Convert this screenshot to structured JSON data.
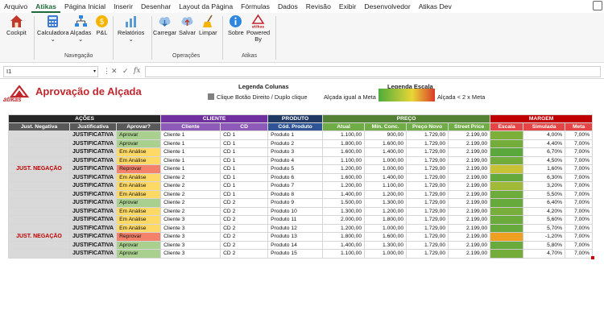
{
  "menu": [
    "Arquivo",
    "Atikas",
    "Página Inicial",
    "Inserir",
    "Desenhar",
    "Layout da Página",
    "Fórmulas",
    "Dados",
    "Revisão",
    "Exibir",
    "Desenvolvedor",
    "Atikas Dev"
  ],
  "menu_active_index": 1,
  "ribbon": {
    "cockpit": "Cockpit",
    "calculadora": "Calculadora",
    "alcadas": "Alçadas",
    "pl": "P&L",
    "relatorios": "Relatórios",
    "group_navegacao": "Navegação",
    "carregar": "Carregar",
    "salvar": "Salvar",
    "limpar": "Limpar",
    "group_operacoes": "Operações",
    "sobre": "Sobre",
    "powered1": "Powered",
    "powered2": "By",
    "group_atikas": "Atikas",
    "logo_small": "atikas"
  },
  "formula": {
    "namebox": "I1",
    "fx": "fx",
    "cancel": "✕",
    "enter": "✓",
    "value": ""
  },
  "sheet": {
    "logo_text": "atikas",
    "title": "Aprovação de Alçada",
    "legend_cols_title": "Legenda Colunas",
    "legend_cols_text": "Clique Botão Direito / Duplo clique",
    "legend_scale_title": "Legenda Escala",
    "legend_scale_left": "Alçada igual a Meta",
    "legend_scale_right": "Alçada < 2 x Meta"
  },
  "table": {
    "groups": [
      "AÇÕES",
      "CLIENTE",
      "PRODUTO",
      "PREÇO",
      "MARGEM"
    ],
    "columns": [
      "Just. Negativa",
      "Justificativa",
      "Aprovar?",
      "Cliente",
      "CD",
      "Cód. Produto",
      "Atual",
      "Mín. Conc.",
      "Preço Novo",
      "Street Price",
      "Escala",
      "Simulada",
      "Meta"
    ],
    "neg_label": "JUST. NEGAÇÃO",
    "rows": [
      {
        "just": "JUSTIFICATIVA",
        "status": "Aprovar",
        "cliente": "Cliente 1",
        "cd": "CD 1",
        "produto": "Produto 1",
        "atual": "1.100,00",
        "min": "900,00",
        "novo": "1.729,00",
        "street": "2.199,00",
        "scale": "#7caf3a",
        "sim": "4,00%",
        "meta": "7,00%"
      },
      {
        "just": "JUSTIFICATIVA",
        "status": "Aprovar",
        "cliente": "Cliente 1",
        "cd": "CD 1",
        "produto": "Produto 2",
        "atual": "1.800,00",
        "min": "1.600,00",
        "novo": "1.729,00",
        "street": "2.199,00",
        "scale": "#74ad3a",
        "sim": "4,40%",
        "meta": "7,00%"
      },
      {
        "just": "JUSTIFICATIVA",
        "status": "Em Análise",
        "cliente": "Cliente 1",
        "cd": "CD 1",
        "produto": "Produto 3",
        "atual": "1.600,00",
        "min": "1.400,00",
        "novo": "1.729,00",
        "street": "2.199,00",
        "scale": "#5aa73c",
        "sim": "6,70%",
        "meta": "7,00%"
      },
      {
        "just": "JUSTIFICATIVA",
        "status": "Em Análise",
        "cliente": "Cliente 1",
        "cd": "CD 1",
        "produto": "Produto 4",
        "atual": "1.100,00",
        "min": "1.000,00",
        "novo": "1.729,00",
        "street": "2.199,00",
        "scale": "#72ad3b",
        "sim": "4,50%",
        "meta": "7,00%"
      },
      {
        "just": "JUSTIFICATIVA",
        "status": "Reprovar",
        "cliente": "Cliente 1",
        "cd": "CD 1",
        "produto": "Produto 5",
        "atual": "1.200,00",
        "min": "1.000,00",
        "novo": "1.729,00",
        "street": "2.199,00",
        "scale": "#c8c236",
        "sim": "1,60%",
        "meta": "7,00%"
      },
      {
        "just": "JUSTIFICATIVA",
        "status": "Em Análise",
        "cliente": "Cliente 2",
        "cd": "CD 1",
        "produto": "Produto 6",
        "atual": "1.600,00",
        "min": "1.400,00",
        "novo": "1.729,00",
        "street": "2.199,00",
        "scale": "#64a93b",
        "sim": "6,30%",
        "meta": "7,00%"
      },
      {
        "just": "JUSTIFICATIVA",
        "status": "Em Análise",
        "cliente": "Cliente 2",
        "cd": "CD 1",
        "produto": "Produto 7",
        "atual": "1.200,00",
        "min": "1.100,00",
        "novo": "1.729,00",
        "street": "2.199,00",
        "scale": "#a0b937",
        "sim": "3,20%",
        "meta": "7,00%"
      },
      {
        "just": "JUSTIFICATIVA",
        "status": "Em Análise",
        "cliente": "Cliente 2",
        "cd": "CD 1",
        "produto": "Produto 8",
        "atual": "1.400,00",
        "min": "1.200,00",
        "novo": "1.729,00",
        "street": "2.199,00",
        "scale": "#6dac3b",
        "sim": "5,50%",
        "meta": "7,00%"
      },
      {
        "just": "JUSTIFICATIVA",
        "status": "Aprovar",
        "cliente": "Cliente 2",
        "cd": "CD 2",
        "produto": "Produto 9",
        "atual": "1.500,00",
        "min": "1.300,00",
        "novo": "1.729,00",
        "street": "2.199,00",
        "scale": "#66aa3b",
        "sim": "6,40%",
        "meta": "7,00%"
      },
      {
        "just": "JUSTIFICATIVA",
        "status": "Em Análise",
        "cliente": "Cliente 2",
        "cd": "CD 2",
        "produto": "Produto 10",
        "atual": "1.300,00",
        "min": "1.200,00",
        "novo": "1.729,00",
        "street": "2.199,00",
        "scale": "#78ae3a",
        "sim": "4,20%",
        "meta": "7,00%"
      },
      {
        "just": "JUSTIFICATIVA",
        "status": "Em Análise",
        "cliente": "Cliente 3",
        "cd": "CD 2",
        "produto": "Produto 11",
        "atual": "2.000,00",
        "min": "1.800,00",
        "novo": "1.729,00",
        "street": "2.199,00",
        "scale": "#6aab3b",
        "sim": "5,60%",
        "meta": "7,00%"
      },
      {
        "just": "JUSTIFICATIVA",
        "status": "Em Análise",
        "cliente": "Cliente 3",
        "cd": "CD 2",
        "produto": "Produto 12",
        "atual": "1.200,00",
        "min": "1.000,00",
        "novo": "1.729,00",
        "street": "2.199,00",
        "scale": "#66aa3b",
        "sim": "5,70%",
        "meta": "7,00%"
      },
      {
        "just": "JUSTIFICATIVA",
        "status": "Reprovar",
        "cliente": "Cliente 3",
        "cd": "CD 2",
        "produto": "Produto 13",
        "atual": "1.800,00",
        "min": "1.600,00",
        "novo": "1.729,00",
        "street": "2.199,00",
        "scale": "#f0a020",
        "sim": "-1,20%",
        "meta": "7,00%"
      },
      {
        "just": "JUSTIFICATIVA",
        "status": "Aprovar",
        "cliente": "Cliente 3",
        "cd": "CD 2",
        "produto": "Produto 14",
        "atual": "1.400,00",
        "min": "1.300,00",
        "novo": "1.729,00",
        "street": "2.199,00",
        "scale": "#68ab3b",
        "sim": "5,80%",
        "meta": "7,00%"
      },
      {
        "just": "JUSTIFICATIVA",
        "status": "Aprovar",
        "cliente": "Cliente 3",
        "cd": "CD 2",
        "produto": "Produto 15",
        "atual": "1.100,00",
        "min": "1.000,00",
        "novo": "1.729,00",
        "street": "2.199,00",
        "scale": "#74ad3a",
        "sim": "4,70%",
        "meta": "7,00%"
      }
    ]
  }
}
